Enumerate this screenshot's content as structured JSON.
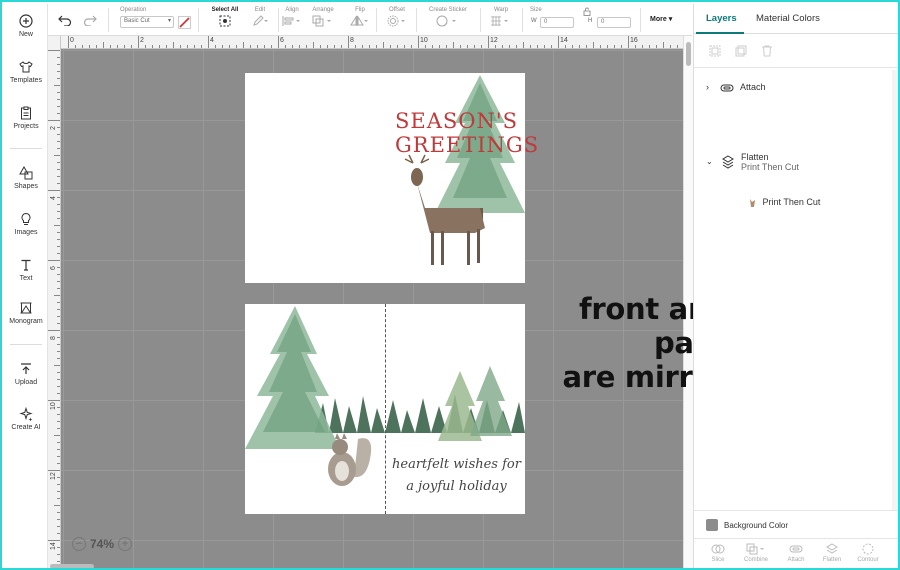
{
  "leftbar": {
    "items": [
      {
        "label": "New",
        "icon": "plus-circle-icon"
      },
      {
        "label": "Templates",
        "icon": "shirt-icon"
      },
      {
        "label": "Projects",
        "icon": "clipboard-icon"
      },
      {
        "label": "Shapes",
        "icon": "shapes-icon"
      },
      {
        "label": "Images",
        "icon": "lightbulb-icon"
      },
      {
        "label": "Text",
        "icon": "text-icon"
      },
      {
        "label": "Monogram",
        "icon": "monogram-icon"
      },
      {
        "label": "Upload",
        "icon": "upload-icon"
      },
      {
        "label": "Create AI",
        "icon": "sparkle-icon"
      }
    ]
  },
  "toolbar": {
    "operation_label": "Operation",
    "operation_value": "Basic Cut",
    "select_all_label": "Select All",
    "edit_label": "Edit",
    "align_label": "Align",
    "arrange_label": "Arrange",
    "flip_label": "Flip",
    "offset_label": "Offset",
    "create_sticker_label": "Create Sticker",
    "warp_label": "Warp",
    "size_label": "Size",
    "width_label": "W",
    "width_value": "0",
    "height_label": "H",
    "height_value": "0",
    "more_label": "More"
  },
  "ruler": {
    "top_labels": [
      "0",
      "2",
      "4",
      "6",
      "8",
      "10",
      "12",
      "14",
      "16"
    ],
    "left_labels": [
      "2",
      "4",
      "6",
      "8",
      "10",
      "12",
      "14"
    ]
  },
  "card": {
    "front_heading_line1": "SEASON'S",
    "front_heading_line2": "GREETINGS",
    "inside_message_line1": "heartfelt wishes for",
    "inside_message_line2": "a joyful holiday"
  },
  "overlay_note_line1": "front and inside panels",
  "overlay_note_line2": "are mirror images",
  "zoom": {
    "minus": "−",
    "value": "74%",
    "plus": "+"
  },
  "right_panel": {
    "tabs": [
      {
        "label": "Layers"
      },
      {
        "label": "Material Colors"
      }
    ],
    "layers": {
      "attach_label": "Attach",
      "flatten_label": "Flatten",
      "flatten_sub": "Print Then Cut",
      "child_label": "Print Then Cut"
    },
    "background_color_label": "Background Color",
    "bottom_actions": [
      "Slice",
      "Combine",
      "Attach",
      "Flatten",
      "Contour"
    ]
  },
  "colors": {
    "accent": "#0b7a7a",
    "canvas_gray": "#8c8c8c",
    "heading_red": "#c0393b",
    "frame_cyan": "#2ad8d8"
  }
}
